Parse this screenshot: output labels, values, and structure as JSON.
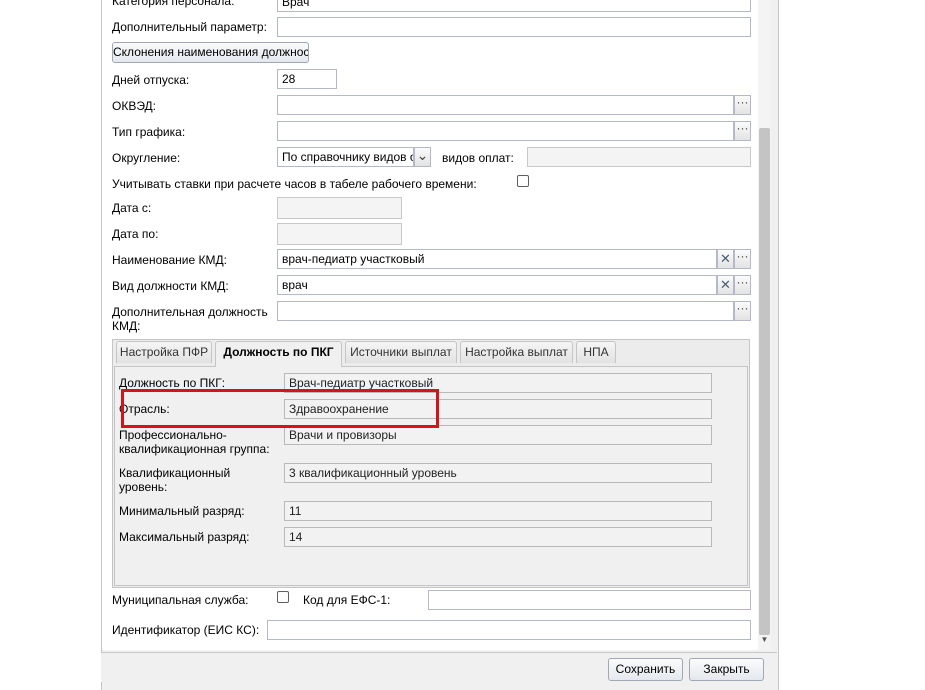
{
  "form": {
    "staff_category": {
      "label": "Категория персонала:",
      "value": "Врач"
    },
    "extra_param": {
      "label": "Дополнительный параметр:",
      "value": ""
    },
    "declension_button": "Склонения наименования должности",
    "vacation_days": {
      "label": "Дней отпуска:",
      "value": "28"
    },
    "okved": {
      "label": "ОКВЭД:",
      "value": ""
    },
    "schedule_type": {
      "label": "Тип графика:",
      "value": ""
    },
    "rounding": {
      "label": "Округление:",
      "value": "По справочнику видов о",
      "payment_types_label": "видов оплат:",
      "payment_types_value": ""
    },
    "account_rates": {
      "label": "Учитывать ставки при расчете часов в табеле рабочего времени:",
      "checked": false
    },
    "date_from": {
      "label": "Дата с:",
      "value": ""
    },
    "date_to": {
      "label": "Дата по:",
      "value": ""
    },
    "kmd_name": {
      "label": "Наименование КМД:",
      "value": "врач-педиатр участковый"
    },
    "kmd_position_type": {
      "label": "Вид должности КМД:",
      "value": "врач"
    },
    "kmd_extra_position": {
      "label": "Дополнительная должность КМД:",
      "value": ""
    },
    "trigger_glyph": "···",
    "clear_glyph": "✕",
    "dropdown_glyph": "⌄"
  },
  "tabs": [
    {
      "label": "Настройка ПФР",
      "active": false
    },
    {
      "label": "Должность по ПКГ",
      "active": true
    },
    {
      "label": "Источники выплат",
      "active": false
    },
    {
      "label": "Настройка выплат",
      "active": false
    },
    {
      "label": "НПА",
      "active": false
    }
  ],
  "pkg": {
    "position": {
      "label": "Должность по ПКГ:",
      "value": "Врач-педиатр участковый"
    },
    "industry": {
      "label": "Отрасль:",
      "value": "Здравоохранение"
    },
    "prof_group": {
      "label": "Профессионально-квалификационная группа:",
      "value": "Врачи и провизоры"
    },
    "qual_level": {
      "label": "Квалификационный уровень:",
      "value": "3 квалификационный уровень"
    },
    "min_grade": {
      "label": "Минимальный разряд:",
      "value": "11"
    },
    "max_grade": {
      "label": "Максимальный разряд:",
      "value": "14"
    }
  },
  "municipal_service": {
    "label": "Муниципальная служба:",
    "checked": false
  },
  "efs_code": {
    "label": "Код для ЕФС-1:",
    "value": ""
  },
  "eis_id": {
    "label": "Идентификатор (ЕИС КС):",
    "value": ""
  },
  "buttons": {
    "save": "Сохранить",
    "close": "Закрыть"
  },
  "scroll_down_glyph": "▼",
  "colors": {
    "highlight": "#d3141a",
    "field_border": "#b5b8c8",
    "panel_bg": "#f0f0f0"
  }
}
